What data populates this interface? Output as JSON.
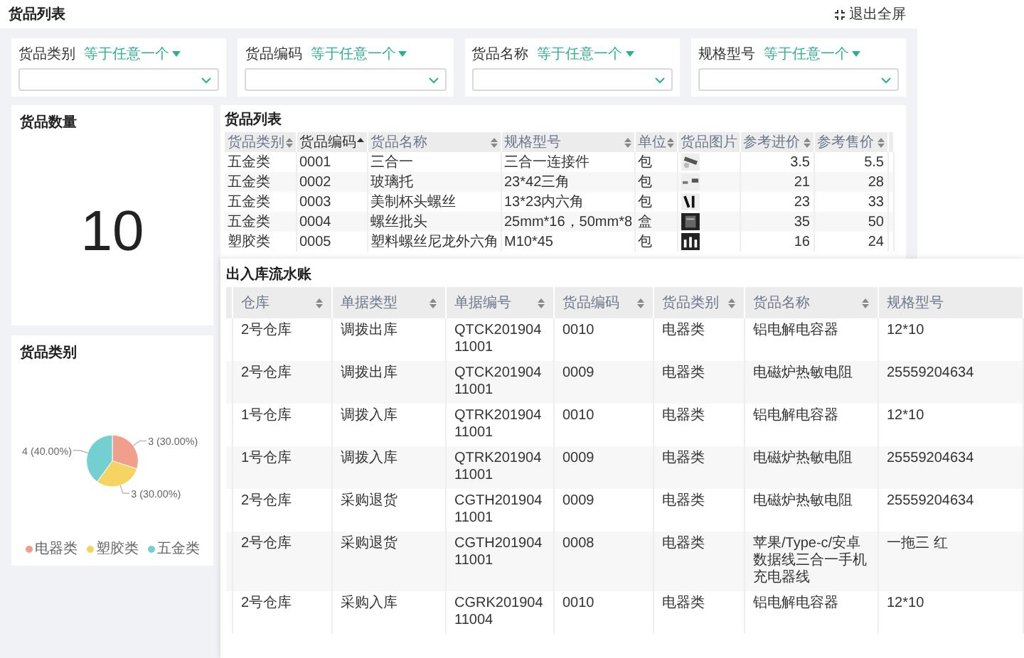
{
  "header": {
    "title": "货品列表",
    "exit_button": "退出全屏"
  },
  "filters": [
    {
      "label": "货品类别",
      "operator": "等于任意一个"
    },
    {
      "label": "货品编码",
      "operator": "等于任意一个"
    },
    {
      "label": "货品名称",
      "operator": "等于任意一个"
    },
    {
      "label": "规格型号",
      "operator": "等于任意一个"
    }
  ],
  "count_card": {
    "title": "货品数量",
    "value": "10"
  },
  "category_card": {
    "title": "货品类别",
    "chart_data": {
      "type": "pie",
      "categories": [
        "电器类",
        "塑胶类",
        "五金类"
      ],
      "series": [
        {
          "values": [
            30,
            30,
            40
          ]
        }
      ],
      "value_labels": [
        "3 (30.00%)",
        "3 (30.00%)",
        "4 (40.00%)"
      ]
    },
    "legend": [
      {
        "color": "#ef9f8b"
      },
      {
        "color": "#f5d461"
      },
      {
        "color": "#74cfd1"
      }
    ]
  },
  "product_table": {
    "title": "货品列表",
    "columns": [
      {
        "label": "货品类别",
        "sortable": true,
        "sorted": false
      },
      {
        "label": "货品编码",
        "sortable": true,
        "sorted": true
      },
      {
        "label": "货品名称",
        "sortable": true,
        "sorted": false
      },
      {
        "label": "规格型号",
        "sortable": true,
        "sorted": false
      },
      {
        "label": "单位",
        "sortable": true,
        "sorted": false
      },
      {
        "label": "货品图片",
        "sortable": false,
        "sorted": false
      },
      {
        "label": "参考进价",
        "sortable": true,
        "sorted": false
      },
      {
        "label": "参考售价",
        "sortable": true,
        "sorted": false
      }
    ],
    "rows": [
      {
        "category": "五金类",
        "code": "0001",
        "name": "三合一",
        "spec": "三合一连接件",
        "unit": "包",
        "cost": "3.5",
        "price": "5.5"
      },
      {
        "category": "五金类",
        "code": "0002",
        "name": "玻璃托",
        "spec": "23*42三角",
        "unit": "包",
        "cost": "21",
        "price": "28"
      },
      {
        "category": "五金类",
        "code": "0003",
        "name": "美制杯头螺丝",
        "spec": "13*23内六角",
        "unit": "包",
        "cost": "23",
        "price": "33"
      },
      {
        "category": "五金类",
        "code": "0004",
        "name": "螺丝批头",
        "spec": "25mm*16，50mm*8",
        "unit": "盒",
        "cost": "35",
        "price": "50"
      },
      {
        "category": "塑胶类",
        "code": "0005",
        "name": "塑料螺丝尼龙外六角",
        "spec": "M10*45",
        "unit": "包",
        "cost": "16",
        "price": "24"
      }
    ]
  },
  "ledger": {
    "title": "出入库流水账",
    "columns": [
      {
        "label": "仓库",
        "sortable": true
      },
      {
        "label": "单据类型",
        "sortable": true
      },
      {
        "label": "单据编号",
        "sortable": true
      },
      {
        "label": "货品编码",
        "sortable": true
      },
      {
        "label": "货品类别",
        "sortable": true
      },
      {
        "label": "货品名称",
        "sortable": true
      },
      {
        "label": "规格型号",
        "sortable": false
      }
    ],
    "rows": [
      [
        "2号仓库",
        "调拨出库",
        "QTCK20190411001",
        "0010",
        "电器类",
        "铝电解电容器",
        "12*10"
      ],
      [
        "2号仓库",
        "调拨出库",
        "QTCK20190411001",
        "0009",
        "电器类",
        "电磁炉热敏电阻",
        "25559204634"
      ],
      [
        "1号仓库",
        "调拨入库",
        "QTRK20190411001",
        "0010",
        "电器类",
        "铝电解电容器",
        "12*10"
      ],
      [
        "1号仓库",
        "调拨入库",
        "QTRK20190411001",
        "0009",
        "电器类",
        "电磁炉热敏电阻",
        "25559204634"
      ],
      [
        "2号仓库",
        "采购退货",
        "CGTH20190411001",
        "0009",
        "电器类",
        "电磁炉热敏电阻",
        "25559204634"
      ],
      [
        "2号仓库",
        "采购退货",
        "CGTH20190411001",
        "0008",
        "电器类",
        "苹果/Type-c/安卓数据线三合一手机充电器线",
        "一拖三 红"
      ],
      [
        "2号仓库",
        "采购入库",
        "CGRK20190411004",
        "0010",
        "电器类",
        "铝电解电容器",
        "12*10"
      ]
    ]
  }
}
